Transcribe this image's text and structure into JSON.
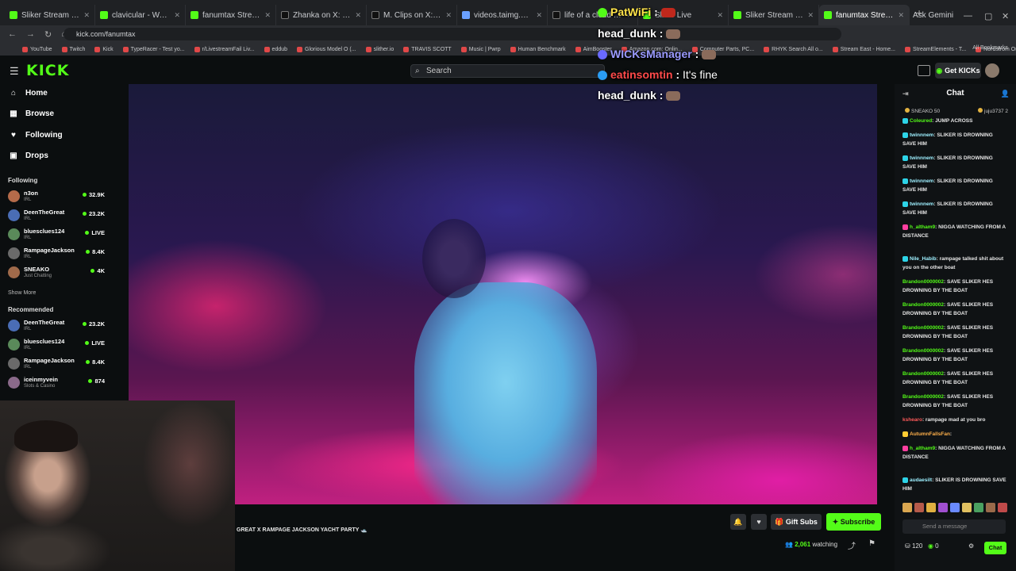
{
  "browser": {
    "tabs": [
      {
        "title": "Sliker Stream - Watch Live",
        "fav": "kick"
      },
      {
        "title": "clavicular - Watch clips on",
        "fav": "kick"
      },
      {
        "title": "fanumtax Stream - Watch",
        "fav": "kick"
      },
      {
        "title": "Zhanka on X: \"@Sliker_Upd",
        "fav": "x"
      },
      {
        "title": "M. Clips on X: \"Sliker tries",
        "fav": "x"
      },
      {
        "title": "videos.taimg.com/amplify",
        "fav": "v"
      },
      {
        "title": "life of a cloud #cloudstre",
        "fav": "x"
      },
      {
        "title": "Sliker Live",
        "fav": "kick"
      },
      {
        "title": "Sliker Stream - Watch Live",
        "fav": "kick"
      },
      {
        "title": "fanumtax Stream - Watch",
        "fav": "kick"
      }
    ],
    "new_tab": "+",
    "gemini": "Ask Gemini",
    "url": "kick.com/fanumtax",
    "bookmarks": [
      "YouTube",
      "Twitch",
      "Kick",
      "TypeRacer - Test yo...",
      "r/LivestreamFail Liv...",
      "eddub",
      "Glorious Model O (...",
      "slither.io",
      "TRAVIS SCOTT",
      "Music | Pwrp",
      "Human Benchmark",
      "AimBooster",
      "Amazon.com: Onlin...",
      "Computer Parts, PC...",
      "RHYK Search All o...",
      "Stream East - Home...",
      "StreamElements - T...",
      "Nordstrom Online..."
    ],
    "all_bookmarks": "All Bookmarks"
  },
  "kick": {
    "logo": "KICK",
    "search_placeholder": "Search",
    "get_kicks": "Get KICKs"
  },
  "sidebar": {
    "nav": [
      {
        "label": "Home",
        "icon": "home-icon",
        "glyph": "⌂"
      },
      {
        "label": "Browse",
        "icon": "browse-icon",
        "glyph": "▦"
      },
      {
        "label": "Following",
        "icon": "heart-icon",
        "glyph": "♥"
      },
      {
        "label": "Drops",
        "icon": "drops-icon",
        "glyph": "▣"
      }
    ],
    "following_title": "Following",
    "following": [
      {
        "name": "n3on",
        "category": "IRL",
        "viewers": "32.9K",
        "color": "#b56b4a"
      },
      {
        "name": "DeenTheGreat",
        "category": "IRL",
        "viewers": "23.2K",
        "color": "#4a6db5"
      },
      {
        "name": "bluesclues124",
        "category": "IRL",
        "viewers": "LIVE",
        "color": "#5a8a5a"
      },
      {
        "name": "RampageJackson",
        "category": "IRL",
        "viewers": "8.4K",
        "color": "#6a6a6a"
      },
      {
        "name": "SNEAKO",
        "category": "Just Chatting",
        "viewers": "4K",
        "color": "#a06a4a"
      }
    ],
    "show_more": "Show More",
    "recommended_title": "Recommended",
    "recommended": [
      {
        "name": "DeenTheGreat",
        "category": "IRL",
        "viewers": "23.2K",
        "color": "#4a6db5"
      },
      {
        "name": "bluesclues124",
        "category": "IRL",
        "viewers": "LIVE",
        "color": "#5a8a5a"
      },
      {
        "name": "RampageJackson",
        "category": "IRL",
        "viewers": "8.4K",
        "color": "#6a6a6a"
      },
      {
        "name": "iceinmyvein",
        "category": "Slots & Casino",
        "viewers": "874",
        "color": "#8a6a8a"
      }
    ]
  },
  "stream": {
    "title": "GREAT X RAMPAGE JACKSON YACHT PARTY 🛥️",
    "gift_subs": "Gift Subs",
    "subscribe": "Subscribe",
    "watching_count": "2,061",
    "watching_label": "watching"
  },
  "overlay": [
    {
      "name": "PatWiFi",
      "sep": " :",
      "text": "",
      "name_class": "n1"
    },
    {
      "name": "head_dunk",
      "sep": " :",
      "text": "",
      "name_class": ""
    },
    {
      "name": "WICKsManager",
      "sep": " :",
      "text": "",
      "name_class": "n2"
    },
    {
      "name": "eatinsomtin",
      "sep": " :",
      "text": " It's fine",
      "name_class": "n3"
    },
    {
      "name": "head_dunk",
      "sep": " :",
      "text": "",
      "name_class": ""
    }
  ],
  "chat": {
    "title": "Chat",
    "pinned_left": "SNEAKO 50",
    "pinned_right": "juju3737 2",
    "messages": [
      {
        "user": "Coleured",
        "text": "JUMP ACROSS",
        "cls": "green",
        "badge": "c"
      },
      {
        "user": "twinnnem",
        "text": "SLIKER IS DROWNING SAVE HIM",
        "cls": "cyan",
        "badge": "c"
      },
      {
        "user": "twinnnem",
        "text": "SLIKER IS DROWNING SAVE HIM",
        "cls": "cyan",
        "badge": "c"
      },
      {
        "user": "twinnnem",
        "text": "SLIKER IS DROWNING SAVE HIM",
        "cls": "cyan",
        "badge": "c"
      },
      {
        "user": "twinnnem",
        "text": "SLIKER IS DROWNING SAVE HIM",
        "cls": "cyan",
        "badge": "c"
      },
      {
        "user": "h_altham9",
        "text": "NIGGA WATCHING FROM A DISTANCE",
        "cls": "green",
        "badge": "p"
      },
      {
        "user": "Nile_Habib",
        "text": "rampage talked shit about you on the other boat",
        "cls": "cyan",
        "badge": "c"
      },
      {
        "user": "Brandon0000002",
        "text": "SAVE SLIKER HES DROWNING BY THE BOAT",
        "cls": "green",
        "badge": ""
      },
      {
        "user": "Brandon0000002",
        "text": "SAVE SLIKER HES DROWNING BY THE BOAT",
        "cls": "green",
        "badge": ""
      },
      {
        "user": "Brandon0000002",
        "text": "SAVE SLIKER HES DROWNING BY THE BOAT",
        "cls": "green",
        "badge": ""
      },
      {
        "user": "Brandon0000002",
        "text": "SAVE SLIKER HES DROWNING BY THE BOAT",
        "cls": "green",
        "badge": ""
      },
      {
        "user": "Brandon0000002",
        "text": "SAVE SLIKER HES DROWNING BY THE BOAT",
        "cls": "green",
        "badge": ""
      },
      {
        "user": "Brandon0000002",
        "text": "SAVE SLIKER HES DROWNING BY THE BOAT",
        "cls": "green",
        "badge": ""
      },
      {
        "user": "kshearo",
        "text": "rampage mad at you bro",
        "cls": "red",
        "badge": ""
      },
      {
        "user": "AutumnFallsFan",
        "text": "",
        "cls": "orange",
        "badge": "y"
      },
      {
        "user": "h_altham9",
        "text": "NIGGA WATCHING FROM A DISTANCE",
        "cls": "green",
        "badge": "p"
      },
      {
        "user": "audaesilt",
        "text": "SLIKER IS DROWNING SAVE HIM",
        "cls": "cyan",
        "badge": "c"
      }
    ],
    "send_placeholder": "Send a message",
    "points": "120",
    "kicks": "0",
    "chat_button": "Chat"
  }
}
